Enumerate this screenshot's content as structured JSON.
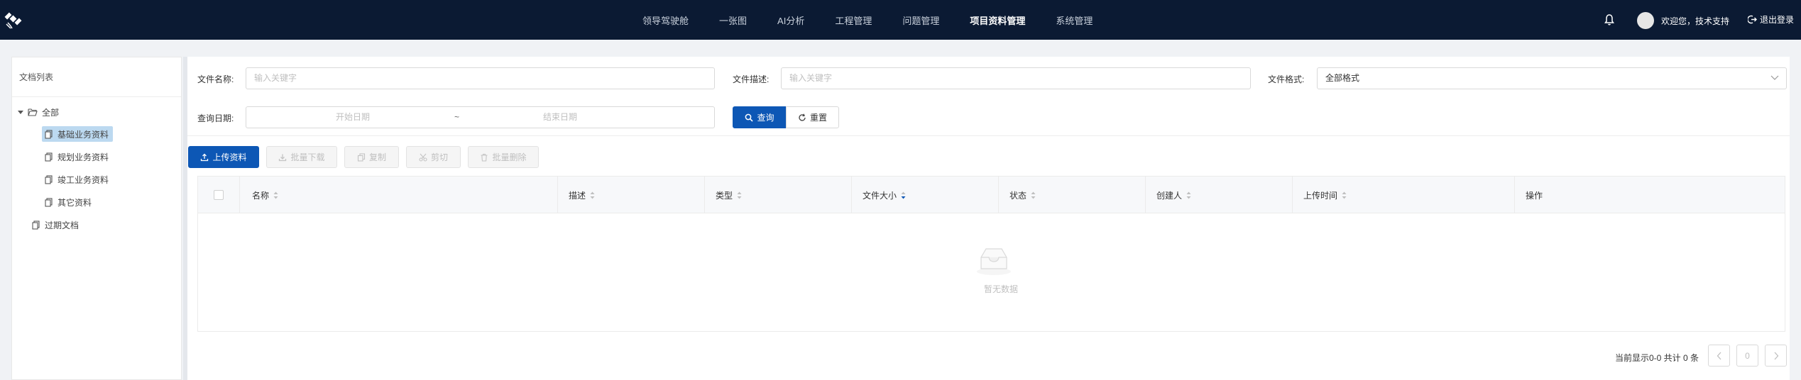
{
  "nav": {
    "items": [
      "领导驾驶舱",
      "一张图",
      "AI分析",
      "工程管理",
      "问题管理",
      "项目资料管理",
      "系统管理"
    ],
    "active": "项目资料管理",
    "user_greeting": "欢迎您，技术支持",
    "logout": "退出登录"
  },
  "left": {
    "title": "文档列表",
    "tree": {
      "root": "全部",
      "children": [
        "基础业务资料",
        "规划业务资料",
        "竣工业务资料",
        "其它资料"
      ],
      "selected": "基础业务资料",
      "expired": "过期文档"
    }
  },
  "filters": {
    "name_label": "文件名称:",
    "name_placeholder": "输入关键字",
    "desc_label": "文件描述:",
    "desc_placeholder": "输入关键字",
    "format_label": "文件格式:",
    "format_value": "全部格式",
    "date_label": "查询日期:",
    "date_start": "开始日期",
    "date_sep": "~",
    "date_end": "结束日期",
    "query": "查询",
    "reset": "重置"
  },
  "toolbar": {
    "upload": "上传资料",
    "batch_download": "批量下载",
    "copy": "复制",
    "cut": "剪切",
    "batch_delete": "批量删除"
  },
  "table": {
    "columns": [
      "名称",
      "描述",
      "类型",
      "文件大小",
      "状态",
      "创建人",
      "上传时间",
      "操作"
    ],
    "empty_text": "暂无数据"
  },
  "pagination": {
    "total_text": "当前显示0-0 共计 0 条",
    "page": "0"
  },
  "colors": {
    "topbar": "#0b1a33",
    "primary": "#0d57b5",
    "selected_node": "#bcd9f0"
  }
}
